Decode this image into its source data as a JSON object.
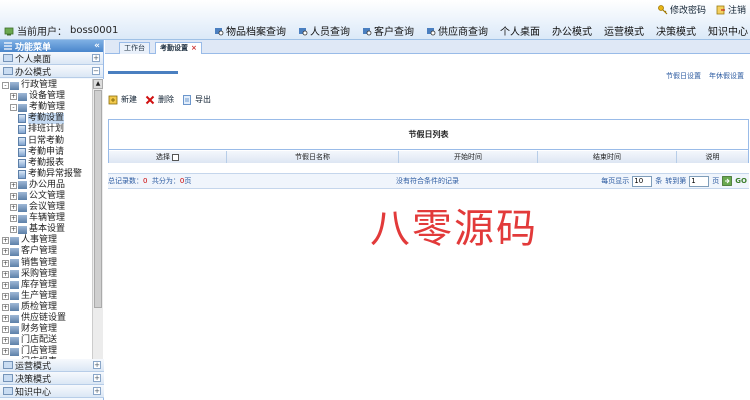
{
  "header": {
    "change_password": "修改密码",
    "logout": "注销",
    "current_user_label": "当前用户：",
    "current_user": "boss0001",
    "nav": [
      "物品档案查询",
      "人员查询",
      "客户查询",
      "供应商查询",
      "个人桌面",
      "办公模式",
      "运营模式",
      "决策模式",
      "知识中心"
    ]
  },
  "sidebar": {
    "title": "功能菜单",
    "collapse": "«",
    "top_sections": [
      "个人桌面",
      "办公模式"
    ],
    "tree": [
      {
        "label": "行政管理",
        "level": 0,
        "exp": "-"
      },
      {
        "label": "设备管理",
        "level": 1,
        "exp": "+"
      },
      {
        "label": "考勤管理",
        "level": 1,
        "exp": "-"
      },
      {
        "label": "考勤设置",
        "level": 2,
        "exp": ""
      },
      {
        "label": "排班计划",
        "level": 2,
        "exp": ""
      },
      {
        "label": "日常考勤",
        "level": 2,
        "exp": ""
      },
      {
        "label": "考勤申请",
        "level": 2,
        "exp": ""
      },
      {
        "label": "考勤报表",
        "level": 2,
        "exp": ""
      },
      {
        "label": "考勤异常报警",
        "level": 2,
        "exp": ""
      },
      {
        "label": "办公用品",
        "level": 1,
        "exp": "+"
      },
      {
        "label": "公文管理",
        "level": 1,
        "exp": "+"
      },
      {
        "label": "会议管理",
        "level": 1,
        "exp": "+"
      },
      {
        "label": "车辆管理",
        "level": 1,
        "exp": "+"
      },
      {
        "label": "基本设置",
        "level": 1,
        "exp": "+"
      },
      {
        "label": "人事管理",
        "level": 0,
        "exp": "+"
      },
      {
        "label": "客户管理",
        "level": 0,
        "exp": "+"
      },
      {
        "label": "销售管理",
        "level": 0,
        "exp": "+"
      },
      {
        "label": "采购管理",
        "level": 0,
        "exp": "+"
      },
      {
        "label": "库存管理",
        "level": 0,
        "exp": "+"
      },
      {
        "label": "生产管理",
        "level": 0,
        "exp": "+"
      },
      {
        "label": "质检管理",
        "level": 0,
        "exp": "+"
      },
      {
        "label": "供应链设置",
        "level": 0,
        "exp": "+"
      },
      {
        "label": "财务管理",
        "level": 0,
        "exp": "+"
      },
      {
        "label": "门店配送",
        "level": 0,
        "exp": "+"
      },
      {
        "label": "门店管理",
        "level": 0,
        "exp": "+"
      },
      {
        "label": "门店报表",
        "level": 0,
        "exp": "+"
      }
    ],
    "bottom_sections": [
      "运营模式",
      "决策模式",
      "知识中心"
    ]
  },
  "tabs": {
    "workbench": "工作台",
    "attendance_settings": "考勤设置",
    "close": "×"
  },
  "links": {
    "holiday_settings": "节假日设置",
    "annual_leave_settings": "年休假设置"
  },
  "toolbar": {
    "new_label": "新建",
    "delete_label": "删除",
    "export_label": "导出"
  },
  "grid": {
    "title": "节假日列表",
    "columns": [
      "选择",
      "节假日名称",
      "开始时间",
      "结束时间",
      "说明"
    ]
  },
  "pager": {
    "total_label": "总记录数：",
    "total_value": "0",
    "pages_label": "共分为：",
    "pages_value": "0",
    "pages_unit": "页",
    "empty_message": "没有符合条件的记录",
    "per_page_label": "每页显示",
    "per_page_value": "10",
    "per_page_unit": "条",
    "goto_label": "转到第",
    "goto_value": "1",
    "goto_unit": "页",
    "go_label": "GO"
  },
  "watermark": "八零源码"
}
